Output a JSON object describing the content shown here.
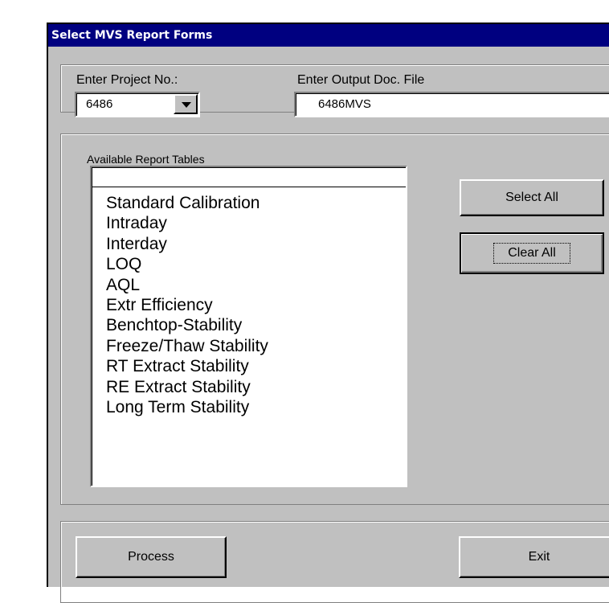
{
  "window": {
    "title": "Select MVS Report Forms"
  },
  "project": {
    "label": "Enter Project No.:",
    "value": "6486"
  },
  "output": {
    "label": "Enter Output Doc. File",
    "value": "6486MVS"
  },
  "report_tables": {
    "label": "Available Report Tables",
    "items": [
      "Standard Calibration",
      "Intraday",
      "Interday",
      "LOQ",
      "AQL",
      "Extr Efficiency",
      "Benchtop-Stability",
      "Freeze/Thaw Stability",
      "RT Extract Stability",
      "RE Extract Stability",
      "Long Term Stability"
    ]
  },
  "buttons": {
    "select_all": "Select All",
    "clear_all": "Clear All",
    "process": "Process",
    "exit": "Exit"
  },
  "icons": {
    "combo_arrow": "chevron-down-icon"
  }
}
